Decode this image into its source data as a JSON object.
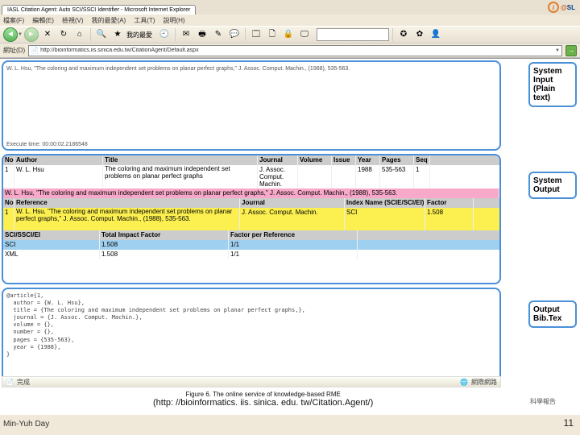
{
  "logo": {
    "i": "i",
    "at": "@",
    "sl": "SL"
  },
  "browser": {
    "tab_title": "IASL Citation Agent: Auto SCI/SSCI Identifier - Microsoft Internet Explorer",
    "menu": [
      "檔案(F)",
      "編輯(E)",
      "檢視(V)",
      "我的最愛(A)",
      "工具(T)",
      "說明(H)"
    ],
    "toolbar": {
      "favorites_label": "我的最愛"
    },
    "address_label": "網址(D)",
    "url": "http://bioinformatics.iis.sinica.edu.tw/CitationAgent/Default.aspx",
    "status": "完成",
    "zone": "網際網路"
  },
  "labels": {
    "system_input": "System Input (Plain text)",
    "system_output": "System Output",
    "output_bibtex": "Output Bib.Tex"
  },
  "citation_input": "W. L. Hsu, \"The coloring and maximum independent set problems on planar perfect graphs,\" J. Assoc. Comput. Machin., (1988), 535-563.",
  "exec_time": "Execute time: 00:00:02.2186548",
  "table1": {
    "headers": [
      "No",
      "Author",
      "Title",
      "Journal",
      "Volume",
      "Issue",
      "Year",
      "Pages",
      "Seq"
    ],
    "row": [
      "1",
      "W. L. Hsu",
      "The coloring and maximum independent set problems on planar perfect graphs",
      "J. Assoc. Comput. Machin.",
      "",
      "",
      "1988",
      "535-563",
      "1"
    ]
  },
  "pink_citation": "W. L. Hsu, \"The coloring and maximum independent set problems on planar perfect graphs,\" J. Assoc. Comput. Machin., (1988), 535-563.",
  "table2": {
    "headers": [
      "No",
      "Reference",
      "Journal",
      "Index Name (SCIE/SCI/EI)",
      "Factor"
    ],
    "row": [
      "1",
      "W. L. Hsu, \"The coloring and maximum independent set problems on planar perfect graphs,\" J. Assoc. Comput. Machin., (1988), 535-563.",
      "J. Assoc. Comput. Machin.",
      "SCI",
      "1.508"
    ]
  },
  "table3": {
    "headers": [
      "SCI/SSCI/EI",
      "Total Impact Factor",
      "Factor per Reference"
    ],
    "rows": [
      [
        "SCI",
        "1.508",
        "1/1"
      ],
      [
        "XML",
        "1.508",
        "1/1"
      ]
    ]
  },
  "bibtex": "@article{1,\n  author = {W. L. Hsu},\n  title = {The coloring and maximum independent set problems on planar perfect graphs,},\n  journal = {J. Assoc. Comput. Machin.},\n  volume = {},\n  number = {},\n  pages = {535-563},\n  year = {1988},\n}",
  "caption": {
    "line1": "Figure 6. The online service of knowledge-based RME",
    "line2": "(http: //bioinformatics. iis. sinica. edu. tw/Citation.Agent/)"
  },
  "footer_name": "Min-Yuh Day",
  "slide_number": "11",
  "slide_credit": "科學報告"
}
